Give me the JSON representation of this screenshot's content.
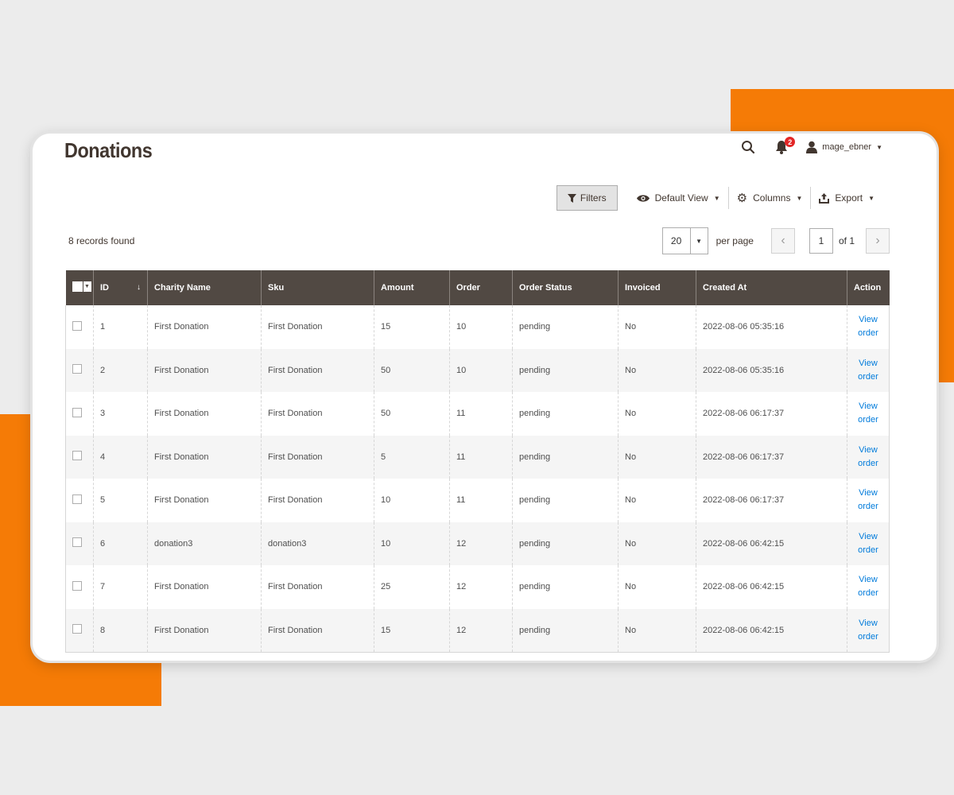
{
  "page": {
    "title": "Donations",
    "user_name": "mage_ebner",
    "notification_count": "2"
  },
  "toolbar": {
    "filters_label": "Filters",
    "view_label": "Default View",
    "columns_label": "Columns",
    "export_label": "Export"
  },
  "grid_info": {
    "records_found": "8 records found",
    "per_page_value": "20",
    "per_page_label": "per page",
    "current_page": "1",
    "of_pages": "of 1"
  },
  "columns": [
    "ID",
    "Charity Name",
    "Sku",
    "Amount",
    "Order",
    "Order Status",
    "Invoiced",
    "Created At",
    "Action"
  ],
  "rows": [
    {
      "id": "1",
      "charity": "First Donation",
      "sku": "First Donation",
      "amount": "15",
      "order": "10",
      "status": "pending",
      "invoiced": "No",
      "created": "2022-08-06 05:35:16",
      "action": "View order"
    },
    {
      "id": "2",
      "charity": "First Donation",
      "sku": "First Donation",
      "amount": "50",
      "order": "10",
      "status": "pending",
      "invoiced": "No",
      "created": "2022-08-06 05:35:16",
      "action": "View order"
    },
    {
      "id": "3",
      "charity": "First Donation",
      "sku": "First Donation",
      "amount": "50",
      "order": "11",
      "status": "pending",
      "invoiced": "No",
      "created": "2022-08-06 06:17:37",
      "action": "View order"
    },
    {
      "id": "4",
      "charity": "First Donation",
      "sku": "First Donation",
      "amount": "5",
      "order": "11",
      "status": "pending",
      "invoiced": "No",
      "created": "2022-08-06 06:17:37",
      "action": "View order"
    },
    {
      "id": "5",
      "charity": "First Donation",
      "sku": "First Donation",
      "amount": "10",
      "order": "11",
      "status": "pending",
      "invoiced": "No",
      "created": "2022-08-06 06:17:37",
      "action": "View order"
    },
    {
      "id": "6",
      "charity": "donation3",
      "sku": "donation3",
      "amount": "10",
      "order": "12",
      "status": "pending",
      "invoiced": "No",
      "created": "2022-08-06 06:42:15",
      "action": "View order"
    },
    {
      "id": "7",
      "charity": "First Donation",
      "sku": "First Donation",
      "amount": "25",
      "order": "12",
      "status": "pending",
      "invoiced": "No",
      "created": "2022-08-06 06:42:15",
      "action": "View order"
    },
    {
      "id": "8",
      "charity": "First Donation",
      "sku": "First Donation",
      "amount": "15",
      "order": "12",
      "status": "pending",
      "invoiced": "No",
      "created": "2022-08-06 06:42:15",
      "action": "View order"
    }
  ],
  "colors": {
    "accent_orange": "#f57b06",
    "header_dark": "#514943",
    "link_blue": "#007bdb",
    "badge_red": "#e22626"
  },
  "icons": [
    "search-icon",
    "bell-icon",
    "user-icon",
    "filter-icon",
    "eye-icon",
    "gear-icon",
    "export-icon",
    "chevron-left-icon",
    "chevron-right-icon"
  ]
}
